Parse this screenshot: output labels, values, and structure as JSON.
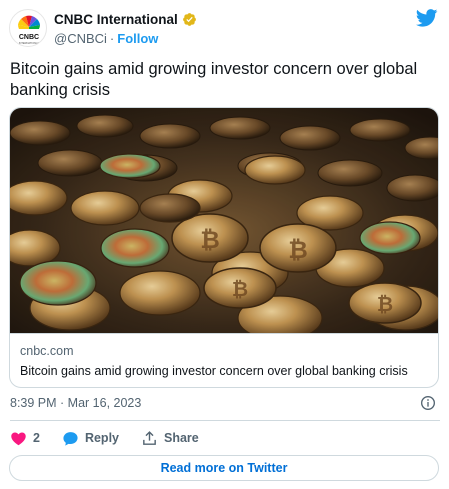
{
  "author": {
    "display_name": "CNBC International",
    "handle": "@CNBCi",
    "separator": "·",
    "follow_label": "Follow",
    "verified": true,
    "avatar_icon": "nbc-peacock-logo",
    "avatar_wordmark": "CNBC",
    "avatar_subtext": "INTERNATIONAL"
  },
  "tweet": {
    "text": "Bitcoin gains amid growing investor concern over global banking crisis"
  },
  "card": {
    "image_subject": "bitcoin coins",
    "domain": "cnbc.com",
    "title": "Bitcoin gains amid growing investor concern over global banking crisis"
  },
  "timestamp": "8:39 PM · Mar 16, 2023",
  "actions": {
    "like_count": "2",
    "reply_label": "Reply",
    "share_label": "Share"
  },
  "read_more_label": "Read more on Twitter",
  "colors": {
    "accent": "#1d9bf0",
    "like": "#f91880",
    "link": "#006fd6",
    "muted": "#536471",
    "border": "#cfd9de"
  }
}
